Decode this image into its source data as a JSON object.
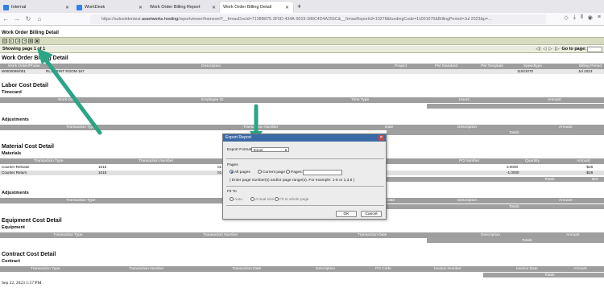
{
  "browser": {
    "tabs": [
      {
        "label": "Internal",
        "color": "#2f80ed"
      },
      {
        "label": "WorkDesk",
        "color": "#2f80ed"
      },
      {
        "label": "Work Order Billing Report",
        "color": ""
      },
      {
        "label": "Work Order Billing Detail",
        "color": ""
      }
    ],
    "new_tab": "+",
    "url_prefix": "https://subsoldentest.",
    "url_host": "assetworks.hosting",
    "url_rest": "/reportviewer/frameset?__frmasDocId=7138B875-3F0D-434A-9019-386C4D4A255C&__frmasReportId=10278&fundingCode=11001070&BillingPeriod=Jul 2023&p=…"
  },
  "report": {
    "header_title": "Work Order Billing Detail",
    "page_info_label": "Showing page",
    "page_current": "1",
    "page_of": "of",
    "page_total": "1",
    "goto_label": "Go to page:",
    "nav_glyphs": [
      "◁|",
      "◁",
      "▷",
      "|▷"
    ],
    "main_title": "Work Order Billing Detail",
    "wo_columns": [
      "Work Order/Phase",
      "Description",
      "Project",
      "PM Standard",
      "PM Template",
      "Speedtype",
      "Billing Period"
    ],
    "wo_row": {
      "wo": "WI000065/001",
      "desc": "RLJ PRINT ROOM 167",
      "speedtype": "11021070",
      "period": "Jul 2023"
    },
    "labor": {
      "title": "Labor Cost Detail",
      "timecard_title": "Timecard",
      "timecard_cols": [
        "Work Date",
        "Employee ID",
        "Time Type",
        "Hours",
        "Amount"
      ],
      "totals_label": "Totals:",
      "adjust_title": "Adjustments",
      "adjust_cols": [
        "Transaction Type",
        "Transaction Number",
        "Date",
        "Description",
        "Amount"
      ]
    },
    "material": {
      "title": "Material Cost Detail",
      "materials_title": "Materials",
      "cols": [
        "Transaction Type",
        "Transaction Number",
        "PO Number",
        "Quantity",
        "Amount"
      ],
      "rows": [
        {
          "type": "Counter Release",
          "num": "1015",
          "num2": "01",
          "qty": "3.0000",
          "amount": "-$26"
        },
        {
          "type": "Counter Return",
          "num": "1015",
          "num2": "01",
          "qty": "-1.0000",
          "amount": "-$28"
        }
      ],
      "totals_label": "Totals:",
      "total_amount": "$16",
      "adjust_title": "Adjustments",
      "adjust_cols": [
        "Transaction Type",
        "Date",
        "Description",
        "Amount"
      ]
    },
    "equipment": {
      "title": "Equipment Cost Detail",
      "sub_title": "Equipment",
      "cols": [
        "Transaction Type",
        "Transaction Number",
        "Transaction Date",
        "Description",
        "Amount"
      ],
      "totals_label": "Totals:"
    },
    "contract": {
      "title": "Contract Cost Detail",
      "sub_title": "Contract",
      "cols": [
        "Transaction Type",
        "Transaction Number",
        "Transaction Date",
        "Description",
        "PO Code",
        "Invoice Number",
        "Invoice Date",
        "Amount"
      ],
      "totals_label": "Totals:"
    },
    "footer_timestamp": "Sep 22, 2023 1:57 PM"
  },
  "dialog": {
    "title": "Export Report",
    "format_label": "Export Format:",
    "format_value": "Excel",
    "pages_label": "Pages",
    "opt_all": "All pages",
    "opt_current": "Current page",
    "opt_pages": "Pages:",
    "pages_hint": "( Enter page number(s) and/or page range(s). For example: 1-8 or 1,3,6 )",
    "fit_label": "Fit To",
    "fit_auto": "Auto",
    "fit_actual": "Actual size",
    "fit_whole": "Fit to whole page",
    "ok": "OK",
    "cancel": "Cancel"
  },
  "colors": {
    "arrow": "#2aa585",
    "header_gray": "#9e9e9e",
    "toolbar": "#d7dcc1"
  }
}
